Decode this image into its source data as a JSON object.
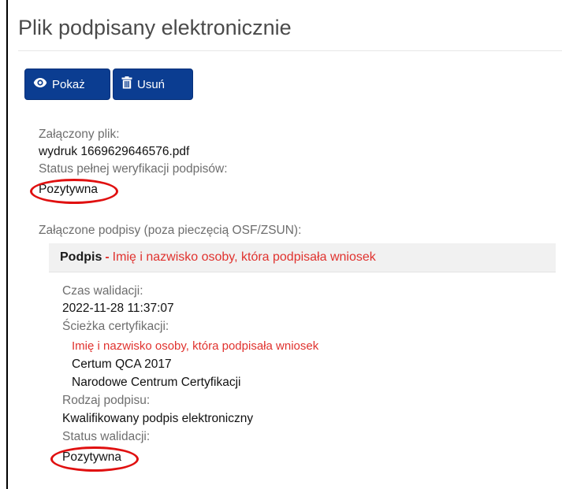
{
  "title": "Plik podpisany elektronicznie",
  "buttons": {
    "show_label": "Pokaż",
    "delete_label": "Usuń",
    "show_icon": "eye-icon",
    "delete_icon": "trash-icon",
    "color": "#0b3d91"
  },
  "file": {
    "attached_label": "Załączony plik:",
    "attached_value": "wydruk 1669629646576.pdf",
    "verification_label": "Status pełnej weryfikacji podpisów:",
    "verification_value": "Pozytywna"
  },
  "signatures": {
    "section_label": "Załączone podpisy (poza pieczęcią OSF/ZSUN):",
    "panel": {
      "title_bold": "Podpis",
      "separator": "-",
      "title_name": "Imię i nazwisko osoby, która podpisała wniosek"
    },
    "validation_time_label": "Czas walidacji:",
    "validation_time_value": "2022-11-28 11:37:07",
    "cert_path_label": "Ścieżka certyfikacji:",
    "cert_path": [
      "Imię i nazwisko osoby, która podpisała wniosek",
      "Certum QCA 2017",
      "Narodowe Centrum Certyfikacji"
    ],
    "type_label": "Rodzaj podpisu:",
    "type_value": "Kwalifikowany podpis elektroniczny",
    "status_label": "Status walidacji:",
    "status_value": "Pozytywna"
  },
  "accent_red": "#e0322e",
  "annotation_color": "#e01010"
}
